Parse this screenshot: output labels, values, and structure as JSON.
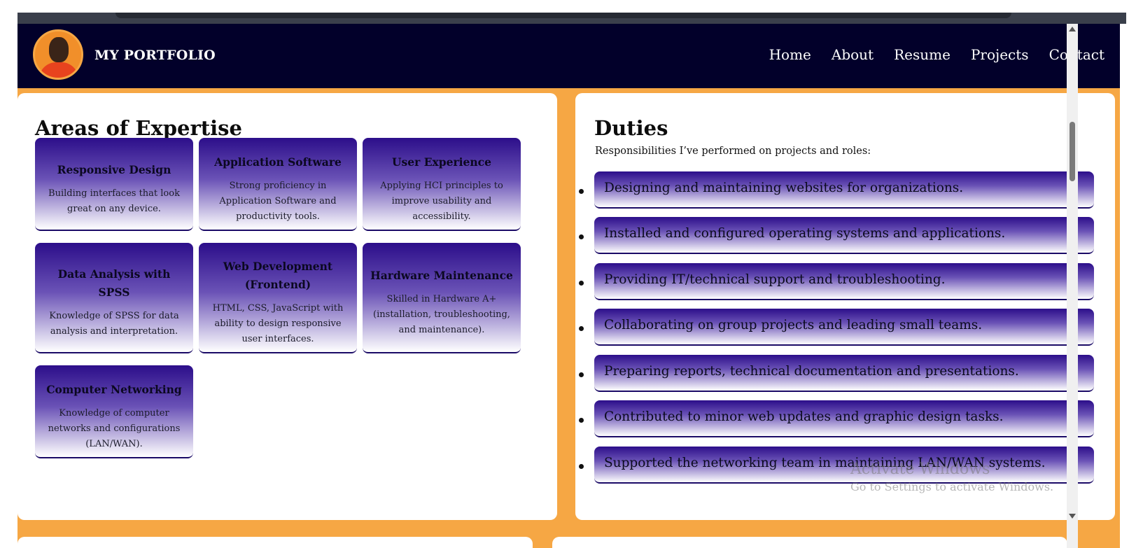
{
  "brand": {
    "title": "MY PORTFOLIO"
  },
  "nav": [
    {
      "label": "Home"
    },
    {
      "label": "About"
    },
    {
      "label": "Resume"
    },
    {
      "label": "Projects"
    },
    {
      "label": "Contact"
    }
  ],
  "expertise": {
    "title": "Areas of Expertise",
    "items": [
      {
        "title": "Responsive Design",
        "desc": "Building interfaces that look great on any device."
      },
      {
        "title": "Application Software",
        "desc": "Strong proficiency in Application Software and productivity tools."
      },
      {
        "title": "User Experience",
        "desc": "Applying HCI principles to improve usability and accessibility."
      },
      {
        "title": "Data Analysis with SPSS",
        "desc": "Knowledge of SPSS for data analysis and interpretation."
      },
      {
        "title": "Web Development (Frontend)",
        "desc": "HTML, CSS, JavaScript with ability to design responsive user interfaces."
      },
      {
        "title": "Hardware Maintenance",
        "desc": "Skilled in Hardware A+ (installation, troubleshooting, and maintenance)."
      },
      {
        "title": "Computer Networking",
        "desc": "Knowledge of computer networks and configurations (LAN/WAN)."
      }
    ]
  },
  "duties": {
    "title": "Duties",
    "subtitle": "Responsibilities I’ve performed on projects and roles:",
    "items": [
      "Designing and maintaining websites for organizations.",
      "Installed and configured operating systems and applications.",
      "Providing IT/technical support and troubleshooting.",
      "Collaborating on group projects and leading small teams.",
      "Preparing reports, technical documentation and presentations.",
      "Contributed to minor web updates and graphic design tasks.",
      "Supported the networking team in maintaining LAN/WAN systems."
    ]
  },
  "watermark": {
    "line1": "Activate Windows",
    "line2": "Go to Settings to activate Windows."
  },
  "colors": {
    "navbar": "#02002a",
    "accent": "#f6a744",
    "card_gradient_top": "#2c0e8a"
  }
}
